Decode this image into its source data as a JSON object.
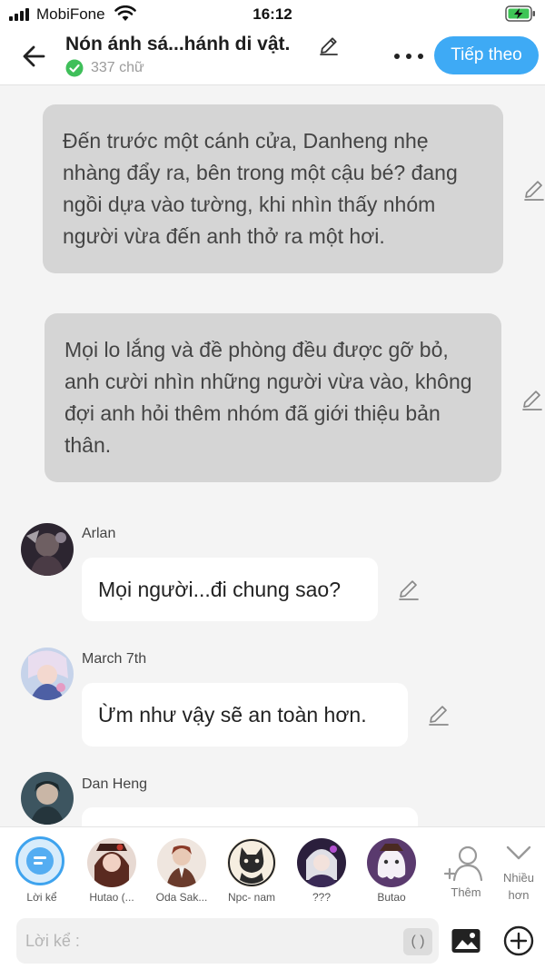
{
  "status_bar": {
    "carrier": "MobiFone",
    "time": "16:12"
  },
  "header": {
    "title": "Nón ánh sá...hánh di vật.",
    "word_count": "337 chữ",
    "next_label": "Tiếp theo"
  },
  "messages": [
    {
      "type": "narration",
      "text": "Đến trước một cánh cửa, Danheng nhẹ nhàng đẩy ra, bên trong một cậu bé? đang ngồi dựa vào tường, khi nhìn thấy nhóm người vừa đến anh thở ra một hơi."
    },
    {
      "type": "narration",
      "text": "Mọi lo lắng và đề phòng đều được gỡ bỏ, anh cười nhìn những người vừa vào, không đợi anh hỏi thêm nhóm đã giới thiệu bản thân."
    },
    {
      "type": "dialogue",
      "name": "Arlan",
      "text": "Mọi người...đi chung sao?"
    },
    {
      "type": "dialogue",
      "name": "March 7th",
      "text": "Ừm như vậy sẽ an toàn hơn."
    },
    {
      "type": "dialogue",
      "name": "Dan Heng",
      "text": ""
    }
  ],
  "characters": [
    {
      "label": "Lời kể"
    },
    {
      "label": "Hutao (..."
    },
    {
      "label": "Oda Sak..."
    },
    {
      "label": "Npc- nam"
    },
    {
      "label": "???"
    },
    {
      "label": "Butao"
    }
  ],
  "add_character_label": "Thêm",
  "more_label_1": "Nhiều",
  "more_label_2": "hơn",
  "input": {
    "placeholder": "Lời kể :",
    "paren_label": "( )"
  },
  "colors": {
    "accent": "#3eaaf5",
    "narration_bg": "#d5d5d5",
    "check": "#3fbf5a"
  }
}
